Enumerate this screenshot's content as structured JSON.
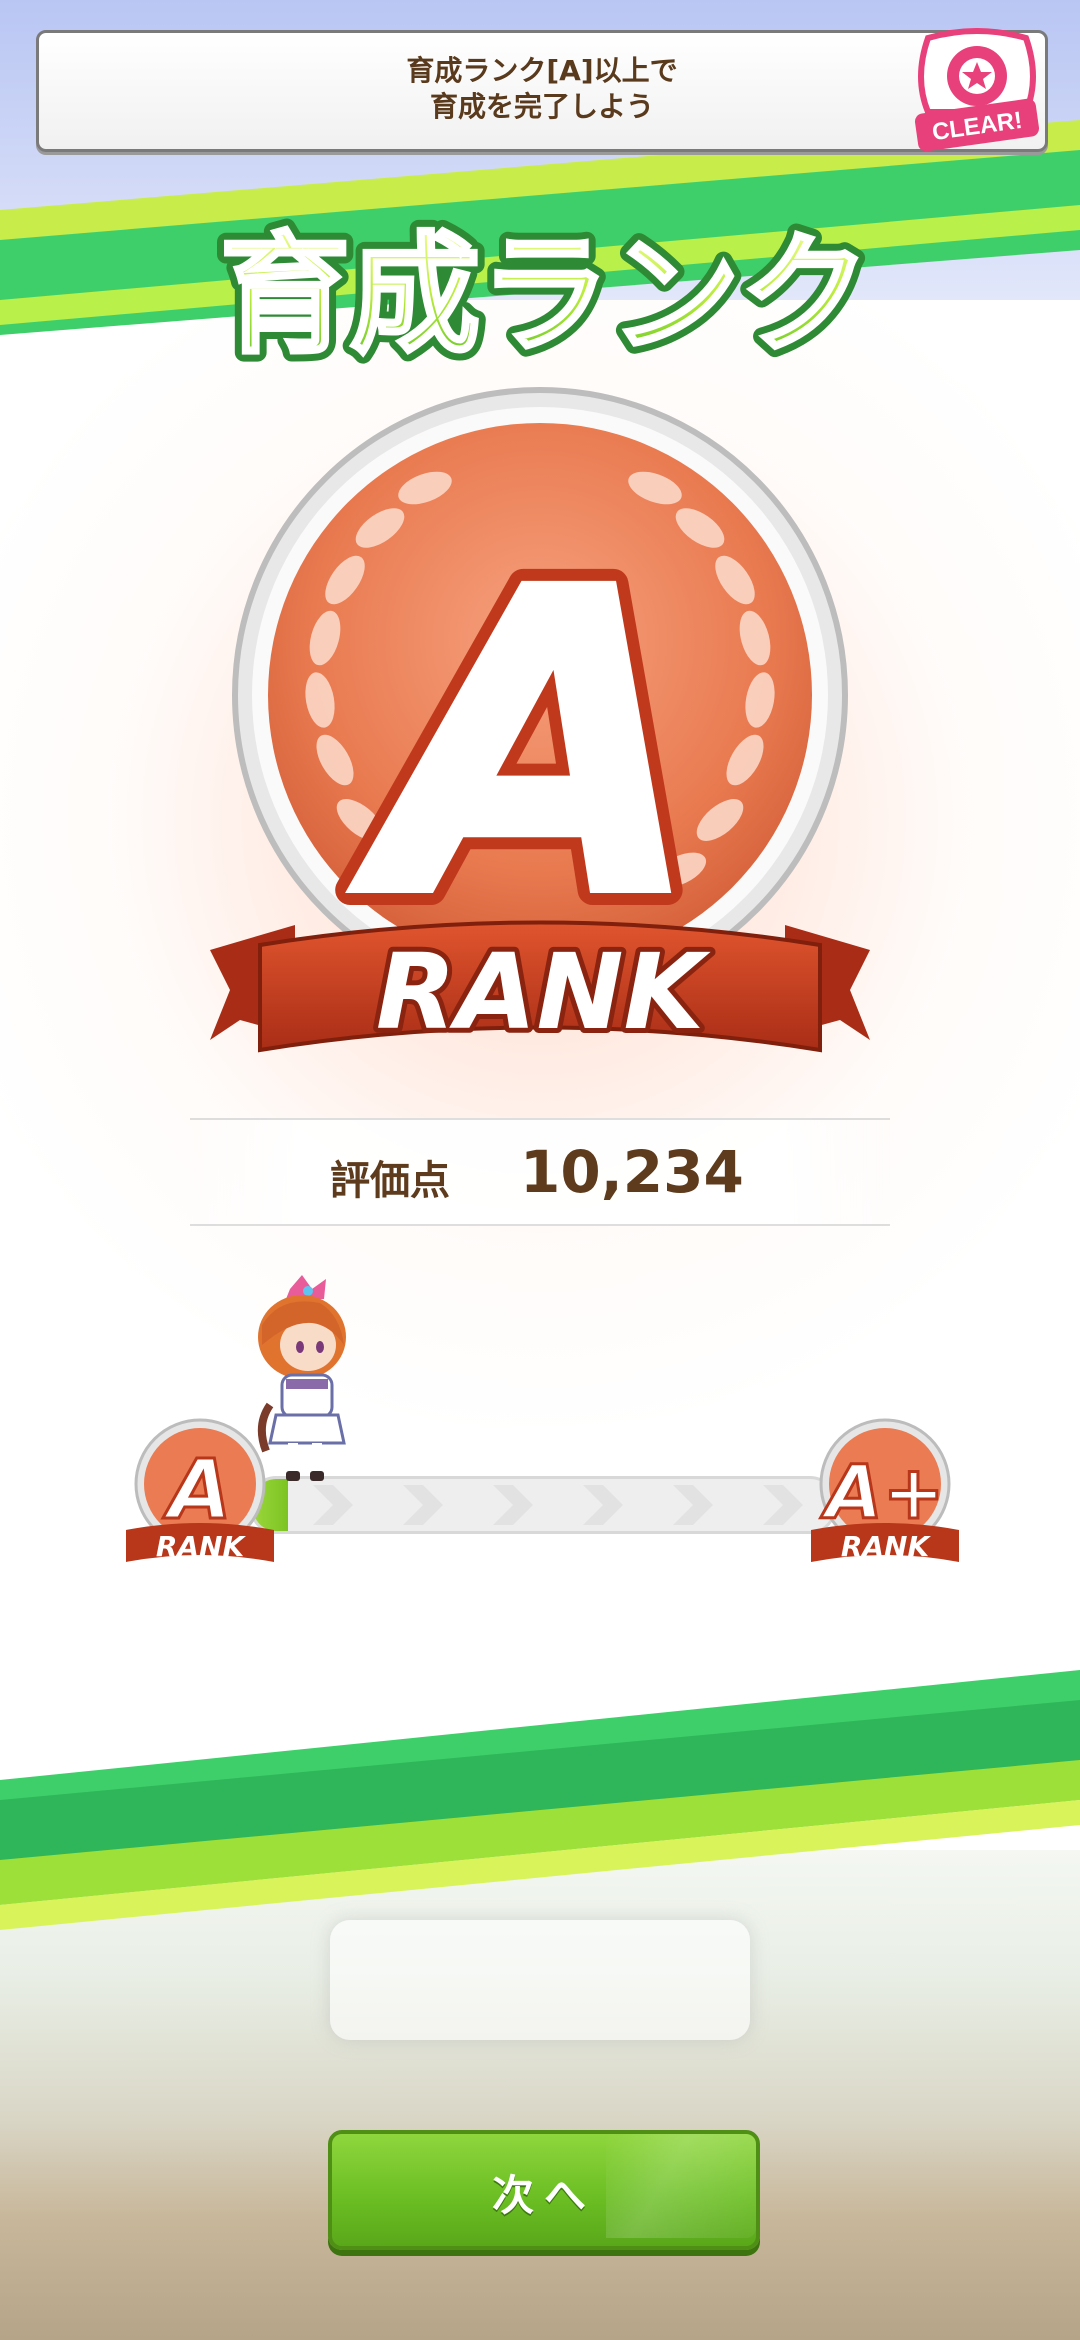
{
  "mission": {
    "line1": "育成ランク[A]以上で",
    "line2": "育成を完了しよう",
    "badge_text": "CLEAR!"
  },
  "title": "育成ランク",
  "rank": {
    "letter": "A",
    "ribbon_text": "RANK"
  },
  "score": {
    "label": "評価点",
    "value": "10,234"
  },
  "progress": {
    "current_rank": "A",
    "current_rank_label": "RANK",
    "next_rank": "A+",
    "next_rank_label": "RANK",
    "fraction": 0.06
  },
  "buttons": {
    "next_label": "次へ"
  },
  "colors": {
    "accent_green": "#6cbf24",
    "rank_orange": "#e8774f",
    "ribbon_red": "#c2391b",
    "text_brown": "#5e3b1c",
    "badge_pink": "#e8407a"
  }
}
